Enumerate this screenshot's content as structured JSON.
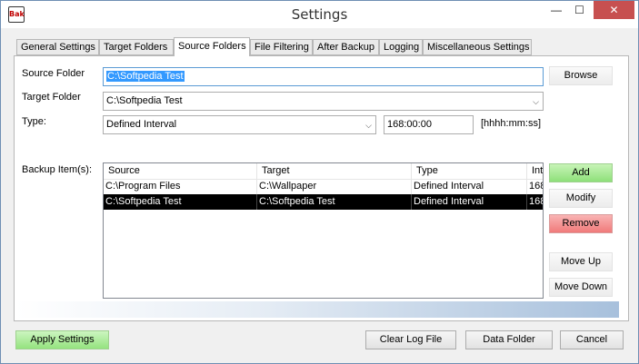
{
  "window": {
    "title": "Settings",
    "app_icon": "Bak"
  },
  "titlebar_buttons": {
    "minimize": "—",
    "maximize": "☐",
    "close": "✕"
  },
  "tabs": [
    {
      "label": "General Settings"
    },
    {
      "label": "Target Folders"
    },
    {
      "label": "Source Folders"
    },
    {
      "label": "File Filtering"
    },
    {
      "label": "After Backup"
    },
    {
      "label": "Logging"
    },
    {
      "label": "Miscellaneous Settings"
    }
  ],
  "form": {
    "source_label": "Source Folder",
    "source_value": "C:\\Softpedia Test",
    "browse_label": "Browse",
    "target_label": "Target Folder",
    "target_value": "C:\\Softpedia Test",
    "type_label": "Type:",
    "type_value": "Defined Interval",
    "interval_value": "168:00:00",
    "interval_hint": "[hhhh:mm:ss]",
    "items_label": "Backup Item(s):"
  },
  "table": {
    "columns": [
      "Source",
      "Target",
      "Type",
      "Int"
    ],
    "rows": [
      {
        "source": "C:\\Program Files",
        "target": "C:\\Wallpaper",
        "type": "Defined Interval",
        "interval": "168",
        "selected": false
      },
      {
        "source": "C:\\Softpedia Test",
        "target": "C:\\Softpedia Test",
        "type": "Defined Interval",
        "interval": "168",
        "selected": true
      }
    ]
  },
  "side_buttons": {
    "add": "Add",
    "modify": "Modify",
    "remove": "Remove",
    "move_up": "Move Up",
    "move_down": "Move Down"
  },
  "bottom_buttons": {
    "apply": "Apply Settings",
    "clear_log": "Clear Log File",
    "data_folder": "Data Folder",
    "cancel": "Cancel"
  },
  "colors": {
    "accent_selection": "#3399ff",
    "add_green": "#8ee07a",
    "remove_red": "#f07a7a",
    "close_red": "#c75050"
  }
}
